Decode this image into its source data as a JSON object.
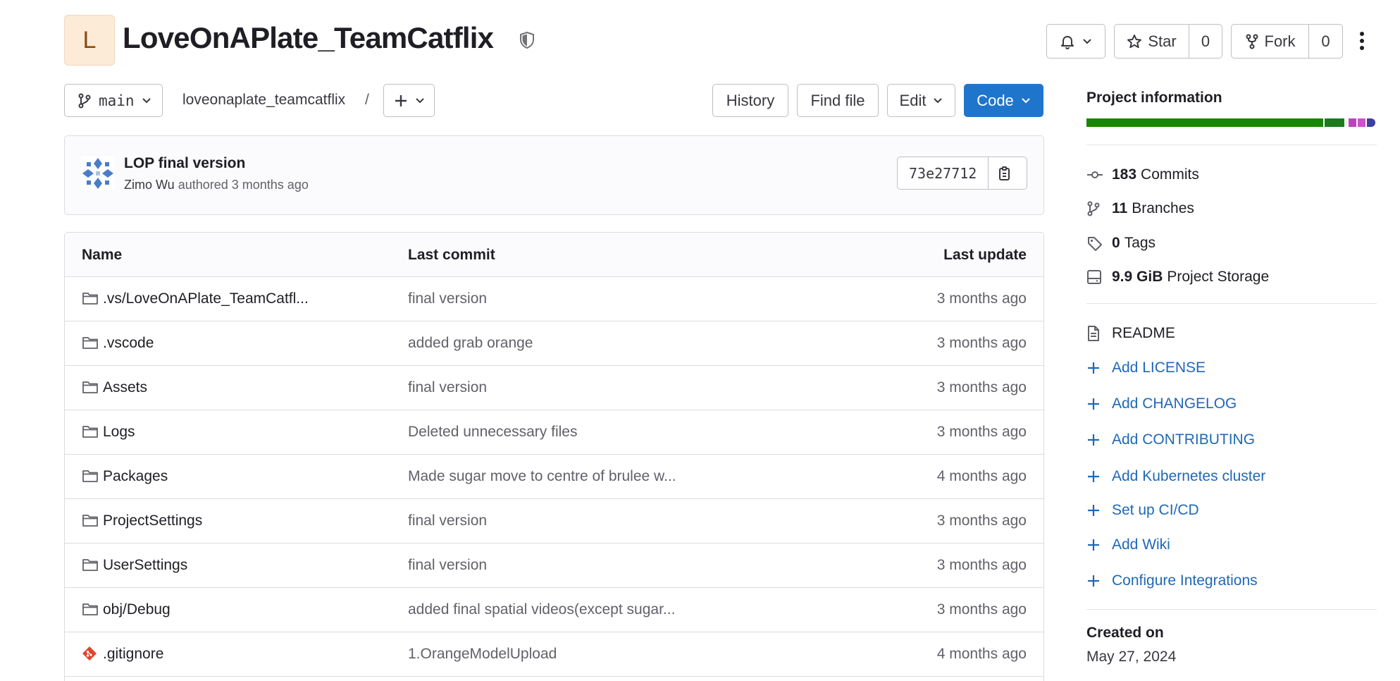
{
  "project": {
    "avatar_letter": "L",
    "title": "LoveOnAPlate_TeamCatflix"
  },
  "header_actions": {
    "star_label": "Star",
    "star_count": "0",
    "fork_label": "Fork",
    "fork_count": "0"
  },
  "toolbar": {
    "branch": "main",
    "path_root": "loveonaplate_teamcatflix",
    "path_separator": "/",
    "history_label": "History",
    "find_file_label": "Find file",
    "edit_label": "Edit",
    "code_label": "Code"
  },
  "last_commit": {
    "message": "LOP final version",
    "author": "Zimo Wu",
    "meta": "authored 3 months ago",
    "sha": "73e27712"
  },
  "file_table": {
    "headers": {
      "name": "Name",
      "last_commit": "Last commit",
      "last_update": "Last update"
    },
    "rows": [
      {
        "type": "folder",
        "name": ".vs/LoveOnAPlate_TeamCatfl...",
        "last_commit": "final version",
        "last_update": "3 months ago"
      },
      {
        "type": "folder",
        "name": ".vscode",
        "last_commit": "added grab orange",
        "last_update": "3 months ago"
      },
      {
        "type": "folder",
        "name": "Assets",
        "last_commit": "final version",
        "last_update": "3 months ago"
      },
      {
        "type": "folder",
        "name": "Logs",
        "last_commit": "Deleted unnecessary files",
        "last_update": "3 months ago"
      },
      {
        "type": "folder",
        "name": "Packages",
        "last_commit": "Made sugar move to centre of brulee w...",
        "last_update": "4 months ago"
      },
      {
        "type": "folder",
        "name": "ProjectSettings",
        "last_commit": "final version",
        "last_update": "3 months ago"
      },
      {
        "type": "folder",
        "name": "UserSettings",
        "last_commit": "final version",
        "last_update": "3 months ago"
      },
      {
        "type": "folder",
        "name": "obj/Debug",
        "last_commit": "added final spatial videos(except sugar...",
        "last_update": "3 months ago"
      },
      {
        "type": "git",
        "name": ".gitignore",
        "last_commit": "1.OrangeModelUpload",
        "last_update": "4 months ago"
      }
    ]
  },
  "sidebar": {
    "heading": "Project information",
    "language_bar_colors": [
      "#178600",
      "#1d7a1d",
      "#f0f0f0",
      "#c040c0",
      "#d050d0",
      "#3f3f9f"
    ],
    "stats": [
      {
        "icon": "commit-icon",
        "value": "183",
        "label": "Commits"
      },
      {
        "icon": "branch-icon",
        "value": "11",
        "label": "Branches"
      },
      {
        "icon": "tag-icon",
        "value": "0",
        "label": "Tags"
      },
      {
        "icon": "storage-icon",
        "value": "9.9 GiB",
        "label": "Project Storage"
      }
    ],
    "readme_label": "README",
    "links": [
      "Add LICENSE",
      "Add CHANGELOG",
      "Add CONTRIBUTING",
      "Add Kubernetes cluster",
      "Set up CI/CD",
      "Add Wiki",
      "Configure Integrations"
    ],
    "created_heading": "Created on",
    "created_value": "May 27, 2024"
  }
}
